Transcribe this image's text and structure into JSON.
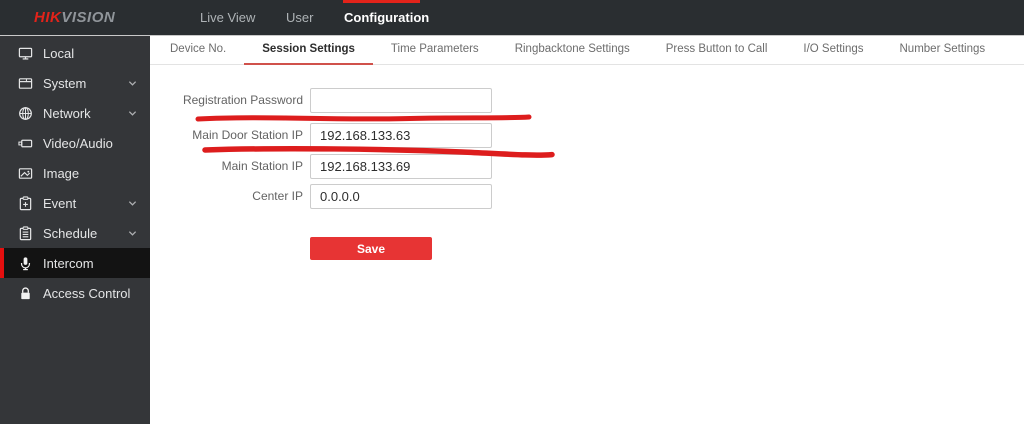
{
  "topbar": {
    "logo": {
      "part1": "HIK",
      "part2": "VISION"
    },
    "nav": [
      {
        "label": "Live View"
      },
      {
        "label": "User"
      },
      {
        "label": "Configuration"
      }
    ],
    "active_nav": "Configuration"
  },
  "sidebar": {
    "items": [
      {
        "label": "Local",
        "icon": "monitor-icon",
        "expandable": false,
        "active": false
      },
      {
        "label": "System",
        "icon": "window-icon",
        "expandable": true,
        "active": false
      },
      {
        "label": "Network",
        "icon": "globe-icon",
        "expandable": true,
        "active": false
      },
      {
        "label": "Video/Audio",
        "icon": "video-icon",
        "expandable": false,
        "active": false
      },
      {
        "label": "Image",
        "icon": "image-icon",
        "expandable": false,
        "active": false
      },
      {
        "label": "Event",
        "icon": "clipboard-icon",
        "expandable": true,
        "active": false
      },
      {
        "label": "Schedule",
        "icon": "schedule-icon",
        "expandable": true,
        "active": false
      },
      {
        "label": "Intercom",
        "icon": "microphone-icon",
        "expandable": false,
        "active": true
      },
      {
        "label": "Access Control",
        "icon": "lock-icon",
        "expandable": false,
        "active": false
      }
    ]
  },
  "tabs": {
    "items": [
      {
        "label": "Device No."
      },
      {
        "label": "Session Settings"
      },
      {
        "label": "Time Parameters"
      },
      {
        "label": "Ringbacktone Settings"
      },
      {
        "label": "Press Button to Call"
      },
      {
        "label": "I/O Settings"
      },
      {
        "label": "Number Settings"
      }
    ],
    "active_tab": "Session Settings"
  },
  "form": {
    "fields": [
      {
        "label": "Registration Password",
        "value": ""
      },
      {
        "label": "Main Door Station IP",
        "value": "192.168.133.63"
      },
      {
        "label": "Main Station IP",
        "value": "192.168.133.69"
      },
      {
        "label": "Center IP",
        "value": "0.0.0.0"
      }
    ],
    "save_label": "Save"
  },
  "colors": {
    "brand_red": "#e2231a",
    "active_stripe_red": "#e50f0f",
    "tab_underline_red": "#d0514b",
    "save_button_red": "#e73434",
    "marker_red": "#dd1d1d",
    "topbar_bg": "#2a2e31",
    "sidebar_bg": "#343639"
  },
  "annotations": {
    "type": "hand-drawn-red-underlines",
    "highlighted_fields": [
      "Registration Password",
      "Main Door Station IP"
    ]
  }
}
